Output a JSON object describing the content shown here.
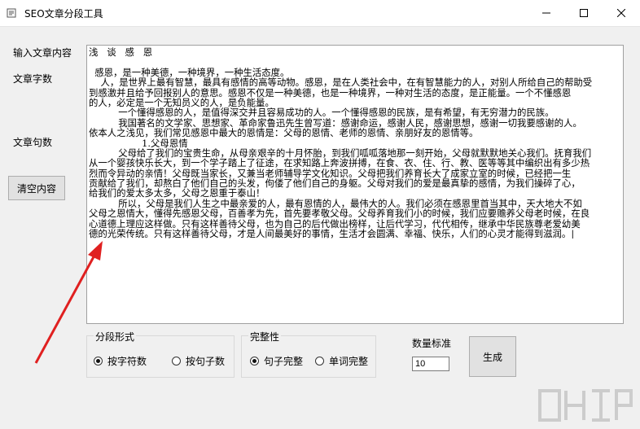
{
  "window": {
    "title": "SEO文章分段工具"
  },
  "labels": {
    "input": "输入文章内容",
    "char_count": "文章字数",
    "sentence_count": "文章句数"
  },
  "buttons": {
    "clear": "清空内容",
    "generate": "生成"
  },
  "article": {
    "lines": [
      "浅   谈   感   恩",
      "",
      "  感恩，是一种美德，一种境界，一种生活态度。",
      "    人，是世界上最有智慧，最具有感情的高等动物。感恩，是在人类社会中，在有智慧能力的人，对别人所给自己的帮助受",
      "到感激并且给予回报别人的意思。感恩不仅是一种美德，也是一种境界，一种对生活的态度，是正能量。一个不懂感恩",
      "的人，必定是一个无知员义的人，是负能量。",
      "          一个懂得感恩的人，是值得深交并且容易成功的人。一个懂得感恩的民族，是有希望，有无穷潜力的民族。",
      "          我国著名的文学家、思想家、革命家鲁迅先生曾写道：感谢命运，感谢人民，感谢思想，感谢一切我要感谢的人。",
      "依本人之浅见，我们常见感恩中最大的恩情是：父母的恩情、老师的恩情、亲朋好友的恩情等。",
      "                  1.父母恩情",
      "          父母给了我们的宝贵生命，从母亲艰辛的十月怀胎，到我们呱呱落地那一刻开始，父母就默默地关心我们。抚育我们",
      "从一个婴孩快乐长大，到一个学子踏上了征途，在求知路上奔波拼搏，在食、衣、住、行、教、医等等其中编织出有多少热",
      "烈而令异动的亲情！父母既当家长，又兼当老师辅导学文化知识。父母把我们养育长大了成家立室的时候，已经把一生",
      "贡献给了我们，却熬白了他们自己的头发，佝偻了他们自己的身躯。父母对我们的爱是最真挚的感情，为我们操碎了心，",
      "给我们的爱太多太多，父母之恩重于泰山！",
      "          所以，父母是我们人生之中最亲爱的人，最有恩情的人，最伟大的人。我们必须在感恩里首当其中，天大地大不如",
      "父母之恩情大，懂得先感恩父母，百善孝为先，首先要孝敬父母。父母养育我们小的时候，我们应要赡养父母老时候，在良",
      "心道德上理应这样做。只有这样善待父母，也为自己的后代做出榜样，让后代学习，代代相传，继承中华民族尊老爱幼美",
      "德的光荣传统。只有这样善待父母，才是人间最美好的事情，生活才会圆满、幸福、快乐，人们的心灵才能得到滋润。|"
    ]
  },
  "segment_mode": {
    "title": "分段形式",
    "options": [
      "按字符数",
      "按句子数"
    ],
    "selected": "按字符数"
  },
  "completeness": {
    "title": "完整性",
    "options": [
      "句子完整",
      "单词完整"
    ],
    "selected": "句子完整"
  },
  "quantity": {
    "label": "数量标准",
    "value": "10"
  },
  "colors": {
    "arrow": "#e02020",
    "titlebar": "#ffffff",
    "window_bg": "#f0f0f0"
  }
}
